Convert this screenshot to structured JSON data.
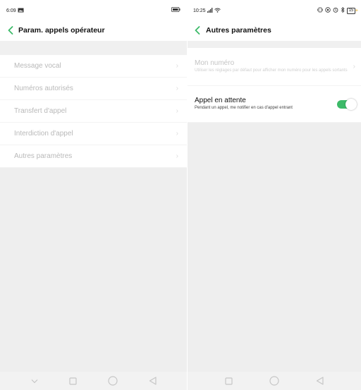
{
  "colors": {
    "accent": "#3cba68",
    "disabled_text": "#b9b9b9",
    "background": "#eeeeee"
  },
  "left": {
    "status": {
      "time": "6:09",
      "notification_icon": "image-icon",
      "battery_icon": "battery-icon"
    },
    "title": "Param. appels opérateur",
    "items": [
      {
        "label": "Message vocal"
      },
      {
        "label": "Numéros autorisés"
      },
      {
        "label": "Transfert d'appel"
      },
      {
        "label": "Interdiction d'appel"
      },
      {
        "label": "Autres paramètres"
      }
    ],
    "nav": [
      "chevron-down-icon",
      "square-icon",
      "circle-icon",
      "triangle-back-icon"
    ]
  },
  "right": {
    "status": {
      "time": "10:25",
      "battery": "15"
    },
    "title": "Autres paramètres",
    "items": [
      {
        "title": "Mon numéro",
        "subtitle": "Utiliser les réglages par défaut pour afficher mon numéro pour les appels sortants",
        "enabled": false
      },
      {
        "title": "Appel en attente",
        "subtitle": "Pendant un appel, me notifier en cas d'appel entrant",
        "enabled": true,
        "toggle_on": true
      }
    ],
    "nav": [
      "square-icon",
      "circle-icon",
      "triangle-back-icon"
    ]
  }
}
